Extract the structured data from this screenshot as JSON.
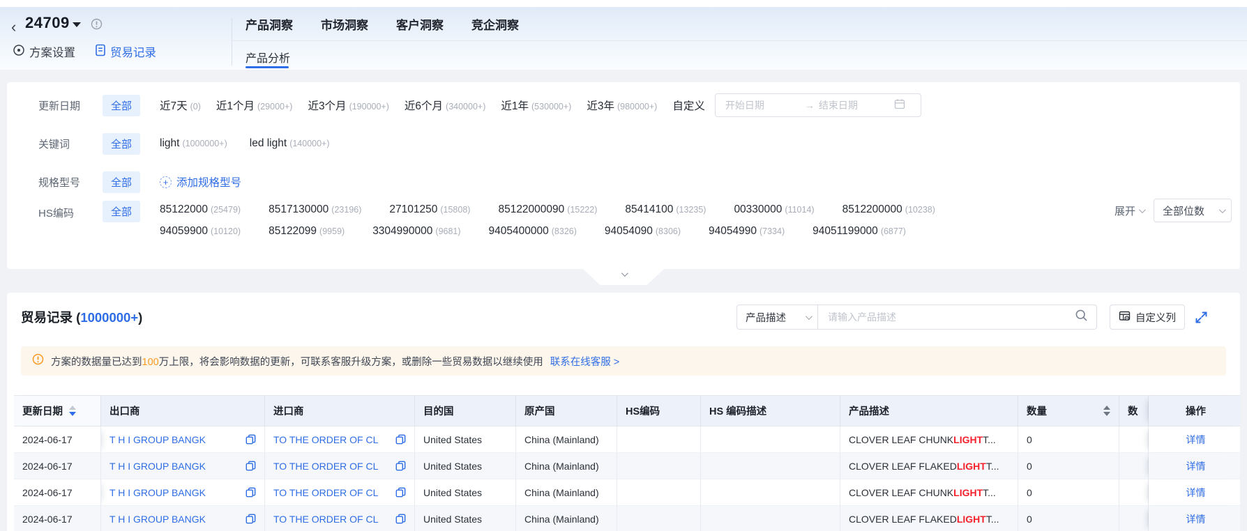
{
  "topbar": {
    "plan_id": "24709",
    "plan_tabs": [
      {
        "label": "方案设置"
      },
      {
        "label": "贸易记录"
      }
    ],
    "nav_tabs": [
      {
        "label": "产品洞察"
      },
      {
        "label": "市场洞察"
      },
      {
        "label": "客户洞察"
      },
      {
        "label": "竞企洞察"
      }
    ],
    "sub_tab": "产品分析"
  },
  "filters": {
    "update_date": {
      "label": "更新日期",
      "all": "全部",
      "options": [
        {
          "name": "近7天",
          "count": "(0)"
        },
        {
          "name": "近1个月",
          "count": "(29000+)"
        },
        {
          "name": "近3个月",
          "count": "(190000+)"
        },
        {
          "name": "近6个月",
          "count": "(340000+)"
        },
        {
          "name": "近1年",
          "count": "(530000+)"
        },
        {
          "name": "近3年",
          "count": "(980000+)"
        }
      ],
      "custom_label": "自定义",
      "start_placeholder": "开始日期",
      "end_placeholder": "结束日期"
    },
    "keyword": {
      "label": "关键词",
      "all": "全部",
      "options": [
        {
          "name": "light",
          "count": "(1000000+)"
        },
        {
          "name": "led light",
          "count": "(140000+)"
        }
      ]
    },
    "spec": {
      "label": "规格型号",
      "all": "全部",
      "add_label": "添加规格型号"
    },
    "hs_code": {
      "label": "HS编码",
      "all": "全部",
      "line1": [
        {
          "name": "85122000",
          "count": "(25479)"
        },
        {
          "name": "8517130000",
          "count": "(23196)"
        },
        {
          "name": "27101250",
          "count": "(15808)"
        },
        {
          "name": "85122000090",
          "count": "(15222)"
        },
        {
          "name": "85414100",
          "count": "(13235)"
        },
        {
          "name": "00330000",
          "count": "(11014)"
        },
        {
          "name": "8512200000",
          "count": "(10238)"
        }
      ],
      "line2": [
        {
          "name": "94059900",
          "count": "(10120)"
        },
        {
          "name": "85122099",
          "count": "(9959)"
        },
        {
          "name": "3304990000",
          "count": "(9681)"
        },
        {
          "name": "9405400000",
          "count": "(8326)"
        },
        {
          "name": "94054090",
          "count": "(8306)"
        },
        {
          "name": "94054990",
          "count": "(7334)"
        },
        {
          "name": "94051199000",
          "count": "(6877)"
        }
      ],
      "expand_label": "展开",
      "digits_label": "全部位数"
    }
  },
  "records": {
    "title_prefix": "贸易记录 (",
    "count": "1000000+",
    "title_suffix": ")",
    "search_type": "产品描述",
    "search_placeholder": "请输入产品描述",
    "customize_label": "自定义列",
    "warning": {
      "pre": "方案的数据量已达到",
      "highlight": "100",
      "post": "万上限，将会影响数据的更新，可联系客服升级方案，或删除一些贸易数据以继续使用",
      "link": "联系在线客服 >"
    }
  },
  "table": {
    "headers": [
      "更新日期",
      "出口商",
      "进口商",
      "目的国",
      "原产国",
      "HS编码",
      "HS 编码描述",
      "产品描述",
      "数量",
      "数",
      "操作"
    ],
    "rows": [
      {
        "date": "2024-06-17",
        "exporter": "T H I GROUP BANGK",
        "importer": "TO THE ORDER OF CL",
        "destination": "United States",
        "origin": "China (Mainland)",
        "hs_code": "",
        "hs_desc": "",
        "product_pre": "CLOVER LEAF CHUNK ",
        "product_highlight": "LIGHT",
        "product_post": " T...",
        "quantity": "0",
        "action": "详情"
      },
      {
        "date": "2024-06-17",
        "exporter": "T H I GROUP BANGK",
        "importer": "TO THE ORDER OF CL",
        "destination": "United States",
        "origin": "China (Mainland)",
        "hs_code": "",
        "hs_desc": "",
        "product_pre": "CLOVER LEAF FLAKED ",
        "product_highlight": "LIGHT",
        "product_post": " T...",
        "quantity": "0",
        "action": "详情"
      },
      {
        "date": "2024-06-17",
        "exporter": "T H I GROUP BANGK",
        "importer": "TO THE ORDER OF CL",
        "destination": "United States",
        "origin": "China (Mainland)",
        "hs_code": "",
        "hs_desc": "",
        "product_pre": "CLOVER LEAF CHUNK ",
        "product_highlight": "LIGHT",
        "product_post": " T...",
        "quantity": "0",
        "action": "详情"
      },
      {
        "date": "2024-06-17",
        "exporter": "T H I GROUP BANGK",
        "importer": "TO THE ORDER OF CL",
        "destination": "United States",
        "origin": "China (Mainland)",
        "hs_code": "",
        "hs_desc": "",
        "product_pre": "CLOVER LEAF FLAKED ",
        "product_highlight": "LIGHT",
        "product_post": " T...",
        "quantity": "0",
        "action": "详情"
      }
    ]
  },
  "colors": {
    "accent": "#2f6de6",
    "link": "#2f6de5",
    "highlight_red": "#f5222d",
    "warning_orange": "#f99a23",
    "warning_bg": "#fdf6ec"
  }
}
